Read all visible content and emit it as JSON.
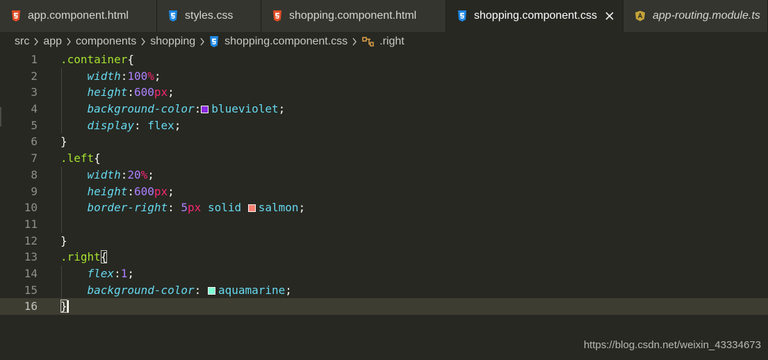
{
  "tabs": [
    {
      "label": "app.component.html",
      "icon": "html5-icon",
      "active": false,
      "italic": false
    },
    {
      "label": "styles.css",
      "icon": "css3-icon",
      "active": false,
      "italic": false
    },
    {
      "label": "shopping.component.html",
      "icon": "html5-icon",
      "active": false,
      "italic": false
    },
    {
      "label": "shopping.component.css",
      "icon": "css3-icon",
      "active": true,
      "italic": false
    },
    {
      "label": "app-routing.module.ts",
      "icon": "angular-icon",
      "active": false,
      "italic": true
    }
  ],
  "breadcrumb": {
    "items": [
      "src",
      "app",
      "components",
      "shopping"
    ],
    "file": "shopping.component.css",
    "symbol": ".right"
  },
  "colors": {
    "blueviolet": "#8a2be2",
    "salmon": "#fa8072",
    "aquamarine": "#7fffd4",
    "html_icon": "#e44d26",
    "css_icon": "#1e88e5",
    "angular_icon": "#c3a33a"
  },
  "editor": {
    "current_line": 16,
    "lines": [
      {
        "n": "1",
        "sel": ".container",
        "open": "{"
      },
      {
        "n": "2",
        "prop": "width",
        "num": "100",
        "unit": "%"
      },
      {
        "n": "3",
        "prop": "height",
        "num": "600",
        "unit": "px"
      },
      {
        "n": "4",
        "prop": "background-color",
        "swatch": "blueviolet",
        "val": "blueviolet"
      },
      {
        "n": "5",
        "prop": "display",
        "val": "flex"
      },
      {
        "n": "6",
        "close": "}"
      },
      {
        "n": "7",
        "sel": ".left",
        "open": "{"
      },
      {
        "n": "8",
        "prop": "width",
        "num": "20",
        "unit": "%"
      },
      {
        "n": "9",
        "prop": "height",
        "num": "600",
        "unit": "px"
      },
      {
        "n": "10",
        "prop": "border-right",
        "num": "5",
        "unit": "px",
        "val": "solid",
        "swatch": "salmon",
        "val2": "salmon"
      },
      {
        "n": "11"
      },
      {
        "n": "12",
        "close": "}"
      },
      {
        "n": "13",
        "sel": ".right",
        "open": "{"
      },
      {
        "n": "14",
        "prop": "flex",
        "num": "1"
      },
      {
        "n": "15",
        "prop": "background-color",
        "swatch": "aquamarine",
        "val": "aquamarine"
      },
      {
        "n": "16",
        "close": "}"
      }
    ]
  },
  "watermark": "https://blog.csdn.net/weixin_43334673"
}
